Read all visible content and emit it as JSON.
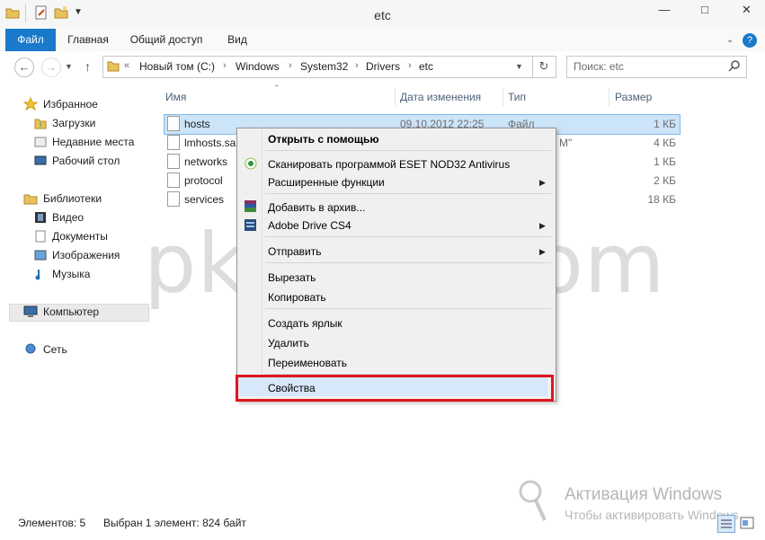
{
  "window": {
    "title": "etc"
  },
  "ribbon": {
    "tabs": [
      "Файл",
      "Главная",
      "Общий доступ",
      "Вид"
    ]
  },
  "address": {
    "overflow": "«",
    "crumbs": [
      "Новый том (C:)",
      "Windows",
      "System32",
      "Drivers",
      "etc"
    ],
    "search_placeholder": "Поиск: etc"
  },
  "nav": {
    "favorites": "Избранное",
    "downloads": "Загрузки",
    "recent": "Недавние места",
    "desktop": "Рабочий стол",
    "libraries": "Библиотеки",
    "video": "Видео",
    "documents": "Документы",
    "images": "Изображения",
    "music": "Музыка",
    "computer": "Компьютер",
    "network": "Сеть"
  },
  "columns": {
    "name": "Имя",
    "date": "Дата изменения",
    "type": "Тип",
    "size": "Размер"
  },
  "files": [
    {
      "name": "hosts",
      "date": "09.10.2012 22:25",
      "type": "Файл",
      "size": "1 КБ"
    },
    {
      "name": "lmhosts.sam",
      "date": "",
      "type": "M\"",
      "size": "4 КБ"
    },
    {
      "name": "networks",
      "date": "",
      "type": "",
      "size": "1 КБ"
    },
    {
      "name": "protocol",
      "date": "",
      "type": "",
      "size": "2 КБ"
    },
    {
      "name": "services",
      "date": "",
      "type": "",
      "size": "18 КБ"
    }
  ],
  "context_menu": {
    "open_with": "Открыть с помощью",
    "scan": "Сканировать программой ESET NOD32 Antivirus",
    "extended": "Расширенные функции",
    "add_archive": "Добавить в архив...",
    "adobe_drive": "Adobe Drive CS4",
    "send_to": "Отправить",
    "cut": "Вырезать",
    "copy": "Копировать",
    "shortcut": "Создать ярлык",
    "delete": "Удалить",
    "rename": "Переименовать",
    "properties": "Свойства"
  },
  "status": {
    "items": "Элементов: 5",
    "selected": "Выбран 1 элемент: 824 байт"
  },
  "overlay": {
    "watermark": "pk-help.com",
    "activation_title": "Активация Windows",
    "activation_text": "Чтобы активировать Windows"
  },
  "colors": {
    "accent": "#1979ca",
    "highlight": "#d6e8f9",
    "red_frame": "#e0161f"
  }
}
